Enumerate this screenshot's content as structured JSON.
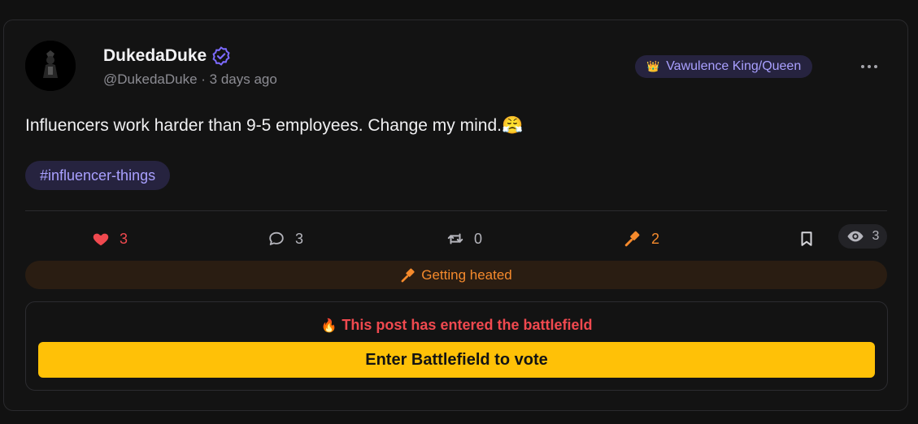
{
  "post": {
    "author": {
      "display_name": "DukedaDuke",
      "handle": "@DukedaDuke",
      "separator": " · ",
      "time_ago": "3 days ago",
      "verified": true
    },
    "role_badge": {
      "icon": "👑",
      "label": "Vawulence King/Queen"
    },
    "text": "Influencers work harder than 9-5 employees. Change my mind.",
    "emoji": "😤",
    "hashtag": "#influencer-things",
    "stats": {
      "likes": "3",
      "comments": "3",
      "reposts": "0",
      "heat": "2",
      "views": "3"
    },
    "heat_status": "Getting heated",
    "battlefield": {
      "icon": "🔥",
      "message": "This post has entered the battlefield",
      "button_label": "Enter Battlefield to vote"
    }
  },
  "colors": {
    "background": "#111111",
    "card": "#131313",
    "accent_purple": "#a9a0ff",
    "badge_bg": "#26233f",
    "like_red": "#f0494f",
    "heat_orange": "#f58a2c",
    "battle_yellow": "#ffc107"
  },
  "icons": {
    "verified": "verified-badge-icon",
    "like": "heart-icon",
    "comment": "comment-icon",
    "repost": "repost-icon",
    "heat": "gavel-icon",
    "bookmark": "bookmark-icon",
    "views": "eye-icon",
    "more": "more-dots-icon"
  }
}
